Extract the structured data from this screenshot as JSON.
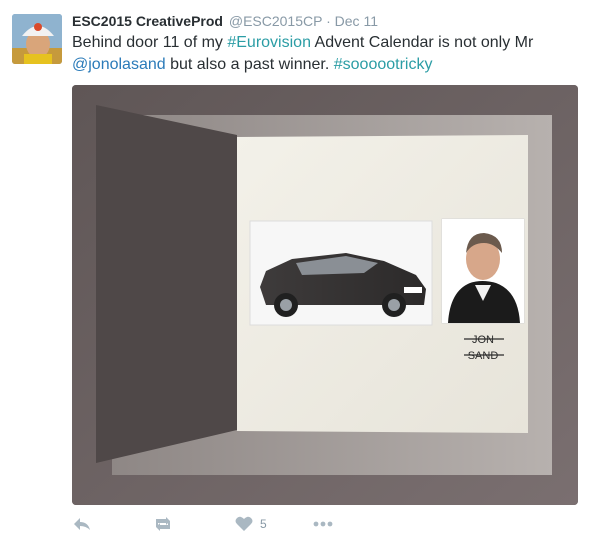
{
  "tweet": {
    "author_name": "ESC2015 CreativeProd",
    "handle": "@ESC2015CP",
    "separator": "·",
    "time": "Dec 11",
    "text": {
      "part1": "Behind door 11 of my ",
      "hashtag1": "#Eurovision",
      "part2": " Advent Calendar is not only Mr ",
      "mention": "@jonolasand",
      "part3": " but also a past winner. ",
      "hashtag2": "#sooooo",
      "hashtag2b": "tricky"
    },
    "image": {
      "caption_line1": "JON",
      "caption_line2": "SAND"
    },
    "actions": {
      "reply_icon": "reply-icon",
      "retweet_icon": "retweet-icon",
      "like_icon": "heart-icon",
      "like_count": "5",
      "more_icon": "more-icon"
    }
  }
}
